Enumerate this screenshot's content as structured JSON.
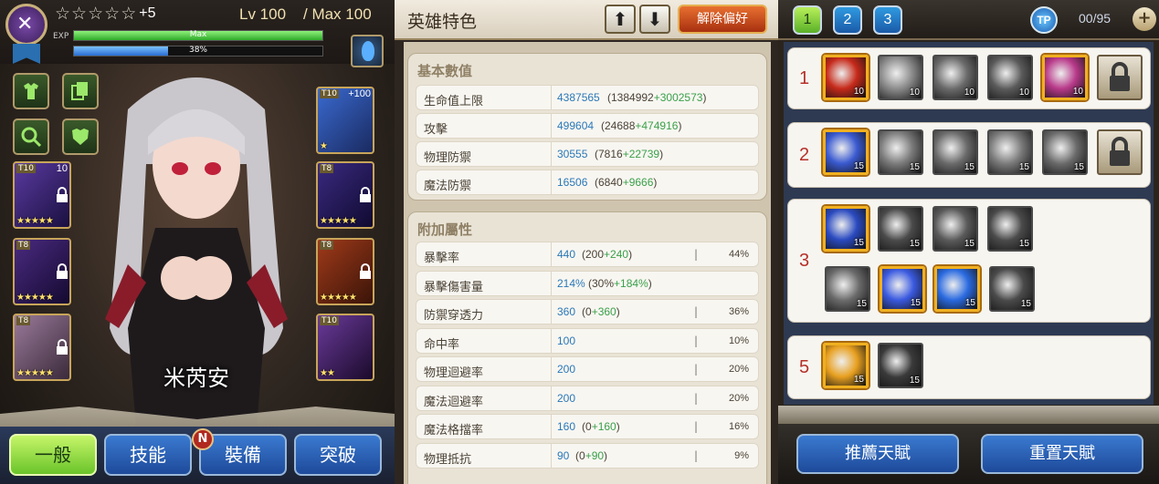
{
  "hero": {
    "stars": 5,
    "star_plus": "+5",
    "level": "Lv 100",
    "max_level": "/ Max 100",
    "exp_label": "EXP",
    "exp_bar_text": "Max",
    "exp_fraction": 1.0,
    "second_bar_text": "38%",
    "second_bar_fraction": 0.38,
    "name": "米芮安"
  },
  "equipment": {
    "left_slots": [
      {
        "tier": "T10",
        "plus": "10",
        "stars": 5
      },
      {
        "tier": "T8",
        "stars": 5
      },
      {
        "tier": "T8",
        "stars": 5
      }
    ],
    "right_slots": [
      {
        "tier": "T10",
        "plus": "+100",
        "stars": 1
      },
      {
        "tier": "T8",
        "stars": 5
      },
      {
        "tier": "T8",
        "stars": 5
      },
      {
        "tier": "T10",
        "stars": 2
      }
    ]
  },
  "bottom_nav": {
    "tabs": [
      "一般",
      "技能",
      "裝備",
      "突破"
    ],
    "active": 0,
    "badge": "N"
  },
  "stats_panel": {
    "title": "英雄特色",
    "fav_button": "解除偏好",
    "basic_title": "基本數值",
    "basic": [
      {
        "name": "生命值上限",
        "value": "4387565",
        "base": "1384992",
        "bonus": "+3002573"
      },
      {
        "name": "攻擊",
        "value": "499604",
        "base": "24688",
        "bonus": "+474916"
      },
      {
        "name": "物理防禦",
        "value": "30555",
        "base": "7816",
        "bonus": "+22739"
      },
      {
        "name": "魔法防禦",
        "value": "16506",
        "base": "6840",
        "bonus": "+9666"
      }
    ],
    "extra_title": "附加屬性",
    "extra": [
      {
        "name": "暴擊率",
        "value": "440",
        "base": "200",
        "bonus": "+240",
        "sep": "|",
        "pct": "44%"
      },
      {
        "name": "暴擊傷害量",
        "value": "214%",
        "base": "30%",
        "bonus": "+184%",
        "sep": "",
        "pct": ""
      },
      {
        "name": "防禦穿透力",
        "value": "360",
        "base": "0",
        "bonus": "+360",
        "sep": "|",
        "pct": "36%"
      },
      {
        "name": "命中率",
        "value": "100",
        "base": "",
        "bonus": "",
        "sep": "|",
        "pct": "10%"
      },
      {
        "name": "物理迴避率",
        "value": "200",
        "base": "",
        "bonus": "",
        "sep": "|",
        "pct": "20%"
      },
      {
        "name": "魔法迴避率",
        "value": "200",
        "base": "",
        "bonus": "",
        "sep": "|",
        "pct": "20%"
      },
      {
        "name": "魔法格擋率",
        "value": "160",
        "base": "0",
        "bonus": "+160",
        "sep": "|",
        "pct": "16%"
      },
      {
        "name": "物理抵抗",
        "value": "90",
        "base": "0",
        "bonus": "+90",
        "sep": "|",
        "pct": "9%"
      }
    ]
  },
  "talents": {
    "pages": [
      "1",
      "2",
      "3"
    ],
    "active_page": 0,
    "tp_icon": "TP",
    "tp_count": "00/95",
    "tiers": [
      {
        "num": "1",
        "rows": [
          [
            {
              "lvl": "10",
              "sel": true,
              "color": "#c62a1a"
            },
            {
              "lvl": "10",
              "sel": false,
              "color": "#8a8a8a"
            },
            {
              "lvl": "10",
              "sel": false,
              "color": "#6a6a6a"
            },
            {
              "lvl": "10",
              "sel": false,
              "color": "#5a5a5a"
            },
            {
              "lvl": "10",
              "sel": true,
              "color": "#b83a8a"
            },
            {
              "lvl": "",
              "sel": false,
              "lock": true
            }
          ]
        ]
      },
      {
        "num": "2",
        "rows": [
          [
            {
              "lvl": "15",
              "sel": true,
              "color": "#3a5ad0"
            },
            {
              "lvl": "15",
              "sel": false,
              "color": "#7a7a7a"
            },
            {
              "lvl": "15",
              "sel": false,
              "color": "#6a6a6a"
            },
            {
              "lvl": "15",
              "sel": false,
              "color": "#7a7a7a"
            },
            {
              "lvl": "15",
              "sel": false,
              "color": "#6a6a6a"
            },
            {
              "lvl": "",
              "sel": false,
              "lock": true
            }
          ]
        ]
      },
      {
        "num": "3",
        "rows": [
          [
            {
              "lvl": "15",
              "sel": true,
              "color": "#2a4ac0"
            },
            {
              "lvl": "15",
              "sel": false,
              "color": "#4a4a4a"
            },
            {
              "lvl": "15",
              "sel": false,
              "color": "#5a5a5a"
            },
            {
              "lvl": "15",
              "sel": false,
              "color": "#4a4a4a"
            }
          ],
          [
            {
              "lvl": "15",
              "sel": false,
              "color": "#6a6a6a"
            },
            {
              "lvl": "15",
              "sel": true,
              "color": "#3a5ae0"
            },
            {
              "lvl": "15",
              "sel": true,
              "color": "#2a6ae0"
            },
            {
              "lvl": "15",
              "sel": false,
              "color": "#4a4a4a"
            }
          ]
        ]
      },
      {
        "num": "5",
        "rows": [
          [
            {
              "lvl": "15",
              "sel": true,
              "color": "#e8a020"
            },
            {
              "lvl": "15",
              "sel": false,
              "color": "#3a3a3a"
            }
          ]
        ]
      }
    ],
    "recommend_button": "推薦天賦",
    "reset_button": "重置天賦"
  }
}
